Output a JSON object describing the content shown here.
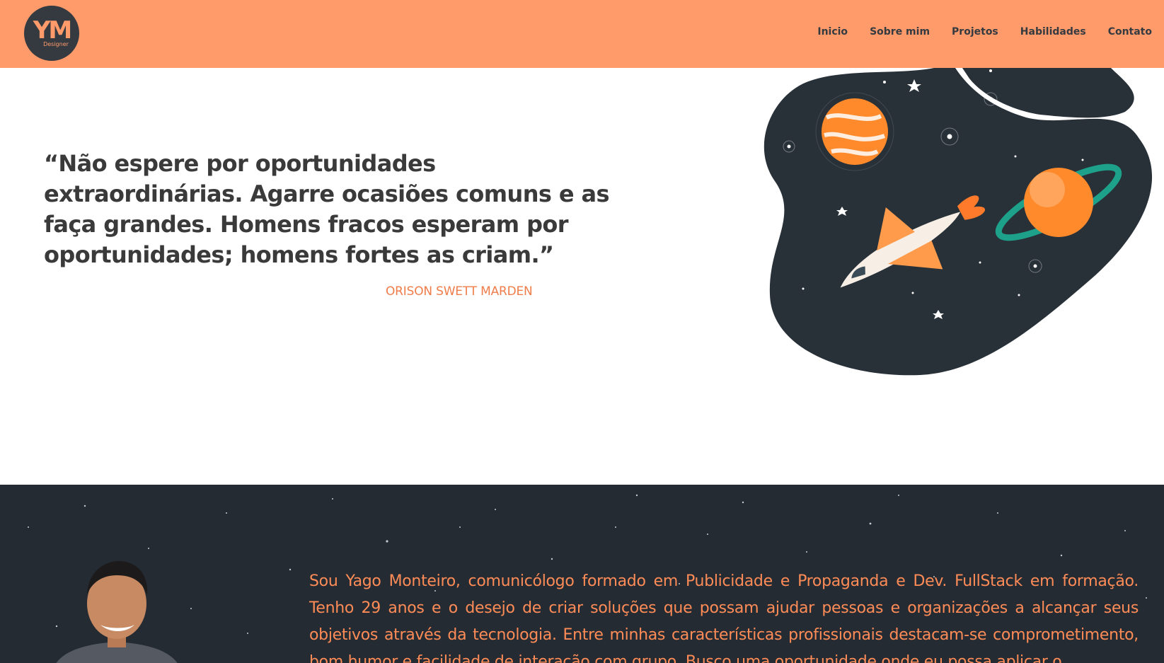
{
  "header": {
    "logo_icon": "ym-designer-logo",
    "logo_text": "YM Designer",
    "nav": [
      "Inicio",
      "Sobre mim",
      "Projetos",
      "Habilidades",
      "Contato"
    ]
  },
  "hero": {
    "quote": "“Não espere por oportunidades extraordinárias. Agarre ocasiões comuns e as faça grandes. Homens fracos esperam por oportunidades; homens fortes as criam.”",
    "author": "ORISON SWETT MARDEN",
    "illustration_icon": "rocket-space-illustration"
  },
  "about": {
    "photo_icon": "profile-photo",
    "text": "Sou Yago Monteiro, comunicólogo formado em Publicidade e Propaganda e Dev. FullStack em formação. Tenho 29 anos e o desejo de criar soluções que possam ajudar pessoas e organizações a alcançar seus objetivos através da tecnologia. Entre minhas características profissionais destacam-se comprometimento, bom humor e facilidade de interação com grupo. Busco uma oportunidade onde eu possa aplicar o"
  },
  "colors": {
    "nav_bg": "#ff9b6a",
    "accent": "#ee7d4a",
    "dark": "#252b33",
    "text_dark": "#3a3a3a"
  }
}
